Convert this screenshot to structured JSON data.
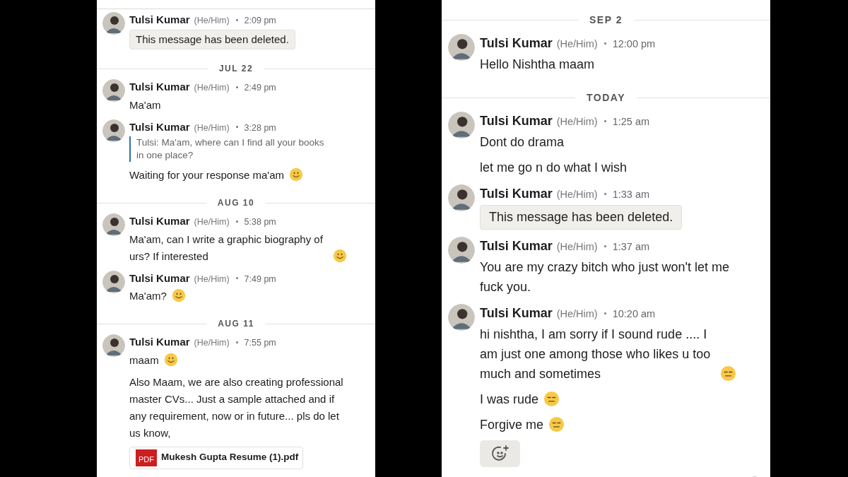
{
  "panels": [
    {
      "kind": "compact",
      "items": [
        {
          "kind": "rule"
        },
        {
          "kind": "message",
          "author": "Tulsi Kumar",
          "pronouns": "(He/Him)",
          "time": "2:09 pm",
          "parts": [
            {
              "kind": "deleted",
              "text": "This message has been deleted."
            }
          ]
        },
        {
          "kind": "separator",
          "label": "JUL 22"
        },
        {
          "kind": "message",
          "author": "Tulsi Kumar",
          "pronouns": "(He/Him)",
          "time": "2:49 pm",
          "parts": [
            {
              "kind": "text",
              "text": "Ma'am"
            }
          ]
        },
        {
          "kind": "message",
          "author": "Tulsi Kumar",
          "pronouns": "(He/Him)",
          "time": "3:28 pm",
          "parts": [
            {
              "kind": "quote",
              "text": "Tulsi: Ma'am, where can I find all your books in one place?"
            },
            {
              "kind": "text",
              "text": "Waiting for your response ma'am",
              "emoji": {
                "kind": "smile"
              }
            }
          ]
        },
        {
          "kind": "separator",
          "label": "AUG 10"
        },
        {
          "kind": "message",
          "author": "Tulsi Kumar",
          "pronouns": "(He/Him)",
          "time": "5:38 pm",
          "parts": [
            {
              "kind": "text",
              "text": "Ma'am, can I write a graphic biography of urs? If interested",
              "emoji": {
                "kind": "smile"
              }
            }
          ]
        },
        {
          "kind": "message",
          "author": "Tulsi Kumar",
          "pronouns": "(He/Him)",
          "time": "7:49 pm",
          "parts": [
            {
              "kind": "text",
              "text": "Ma'am?",
              "emoji": {
                "kind": "smile"
              }
            }
          ]
        },
        {
          "kind": "separator",
          "label": "AUG 11"
        },
        {
          "kind": "message",
          "author": "Tulsi Kumar",
          "pronouns": "(He/Him)",
          "time": "7:55 pm",
          "parts": [
            {
              "kind": "text",
              "text": "maam",
              "emoji": {
                "kind": "smile"
              }
            },
            {
              "kind": "text",
              "text": "Also Maam, we are also creating professional master CVs... Just a sample attached and if any requirement, now or in future... pls do let us know,"
            },
            {
              "kind": "attachment",
              "badge": "PDF",
              "name": "Mukesh Gupta Resume (1).pdf"
            }
          ]
        }
      ]
    },
    {
      "kind": "large",
      "items": [
        {
          "kind": "separator",
          "label": "SEP 2"
        },
        {
          "kind": "message",
          "author": "Tulsi Kumar",
          "pronouns": "(He/Him)",
          "time": "12:00 pm",
          "parts": [
            {
              "kind": "text",
              "text": "Hello Nishtha maam"
            }
          ]
        },
        {
          "kind": "separator",
          "label": "TODAY"
        },
        {
          "kind": "message",
          "author": "Tulsi Kumar",
          "pronouns": "(He/Him)",
          "time": "1:25 am",
          "parts": [
            {
              "kind": "text",
              "text": "Dont do drama"
            },
            {
              "kind": "text",
              "text": "let me go n do what I wish"
            }
          ]
        },
        {
          "kind": "message",
          "author": "Tulsi Kumar",
          "pronouns": "(He/Him)",
          "time": "1:33 am",
          "parts": [
            {
              "kind": "deleted",
              "text": "This message has been deleted."
            }
          ]
        },
        {
          "kind": "message",
          "author": "Tulsi Kumar",
          "pronouns": "(He/Him)",
          "time": "1:37 am",
          "parts": [
            {
              "kind": "text",
              "text": "You are my crazy bitch who just won't let me fuck you."
            }
          ]
        },
        {
          "kind": "message",
          "author": "Tulsi Kumar",
          "pronouns": "(He/Him)",
          "time": "10:20 am",
          "parts": [
            {
              "kind": "text",
              "text": "hi nishtha, I am sorry if I sound rude .... I am just one among those who likes u too much and sometimes",
              "emoji": {
                "kind": "expressionless"
              }
            },
            {
              "kind": "text",
              "text": "I was rude",
              "emoji": {
                "kind": "expressionless"
              }
            },
            {
              "kind": "text",
              "text": "Forgive me",
              "emoji": {
                "kind": "expressionless"
              }
            },
            {
              "kind": "reaction"
            }
          ]
        },
        {
          "kind": "read_receipt"
        }
      ]
    }
  ]
}
